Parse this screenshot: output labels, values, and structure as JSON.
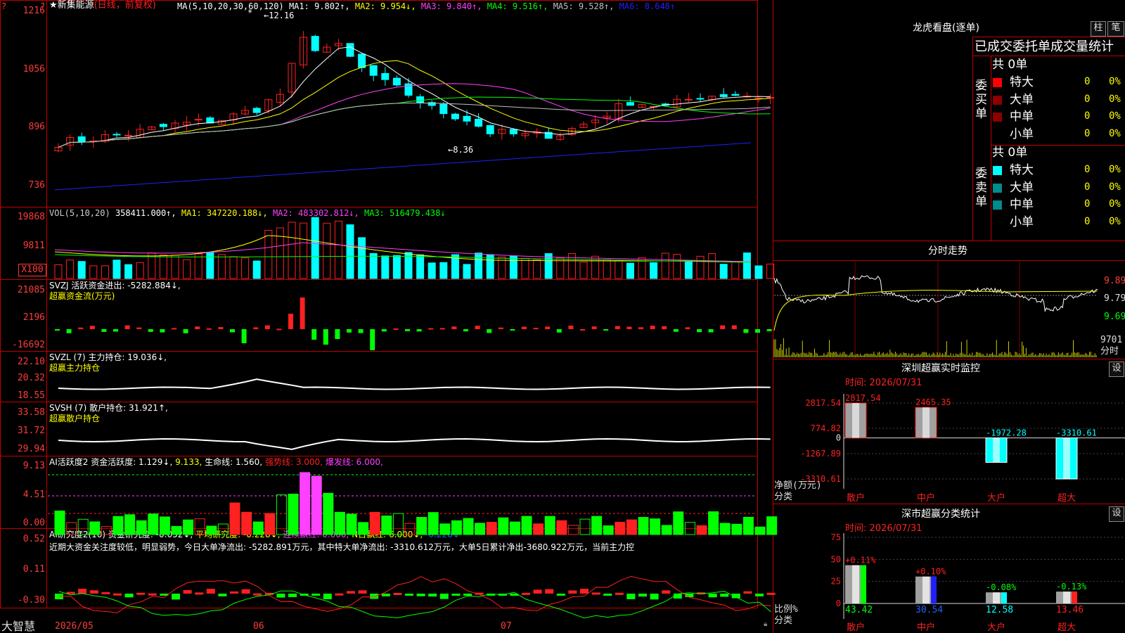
{
  "colors": {
    "up": "#ff2020",
    "down": "#00ffff",
    "green": "#00ff00",
    "yellow": "#ffff00",
    "magenta": "#ff40ff",
    "white": "#ffffff",
    "axis": "#ff3b3b",
    "ma1": "#ffffff",
    "ma2": "#ffff00",
    "ma3": "#ff40ff",
    "ma4": "#00ff00",
    "ma5": "#c0c0c0",
    "ma6": "#2020ff"
  },
  "main": {
    "stock_name": "★新集能源",
    "mode": "(日线，前复权)",
    "ma_label": "MA(5,10,20,30,60,120)",
    "ma1": "MA1: 9.802↑,",
    "ma2": "MA2: 9.954↓,",
    "ma3": "MA3: 9.840↑,",
    "ma4": "MA4: 9.516↑,",
    "ma5": "MA5: 9.528↑,",
    "ma6": "MA6: 8.648↑",
    "y_ticks": [
      "1216",
      "1056",
      "896",
      "736"
    ],
    "high_marker": "12.16",
    "low_marker": "8.36"
  },
  "vol": {
    "label": "VOL(5,10,20)",
    "value": "358411.000↑,",
    "ma1": "MA1: 347220.188↓,",
    "ma2": "MA2: 483302.812↓,",
    "ma3": "MA3: 516479.438↓",
    "y_ticks": [
      "19868",
      "9811"
    ],
    "unit": "X100"
  },
  "svzj": {
    "label": "SVZJ  活跃资金进出: -5282.884↓,",
    "sub": "超赢资金流(万元)",
    "y_ticks": [
      "21085",
      "2196",
      "-16692"
    ]
  },
  "svzl": {
    "label": "SVZL (7) 主力持仓: 19.036↓,",
    "sub": "超赢主力持仓",
    "y_ticks": [
      "22.10",
      "20.32",
      "18.55"
    ]
  },
  "svsh": {
    "label": "SVSH (7) 散户持仓: 31.921↑,",
    "sub": "超赢散户持仓",
    "y_ticks": [
      "33.58",
      "31.72",
      "29.94"
    ]
  },
  "ai1": {
    "a": "AI活跃度2 资金活跃度: 1.129↓,",
    "b": "9.133,",
    "c": "生命线: 1.560,",
    "d": "强势线: 3.000,",
    "e": "爆发线: 6.000,",
    "y_ticks": [
      "9.13",
      "4.51",
      "0.00"
    ]
  },
  "ai2": {
    "a": "AI研究度2(10) 资金研究度: -0.052↓,",
    "b": "平均研究度: -0.228↓,",
    "c": "连续飘红: 0.000,",
    "d": "N日飘红: 6.000↓,",
    "e": "-0.228↓",
    "note": "近期大资金关注度较低，明显弱势，今日大单净流出: -5282.891万元，其中特大单净流出: -3310.612万元，大单5日累计净出-3680.922万元，当前主力控",
    "y_ticks": [
      "0.52",
      "0.11",
      "-0.30"
    ]
  },
  "x_axis": {
    "labels": [
      "2026/05",
      "06",
      "07"
    ]
  },
  "logo": "大智慧",
  "dragon": {
    "title": "龙虎看盘(逐单)",
    "tab_pillar": "柱",
    "tab_pen": "笔",
    "header": "已成交委托单成交量统计",
    "buy_total": "共 0单",
    "buy_label": "委买单",
    "sell_total": "共 0单",
    "sell_label": "委卖单",
    "buy_rows": [
      {
        "name": "特大",
        "val": "0",
        "pct": "0%"
      },
      {
        "name": "大单",
        "val": "0",
        "pct": "0%"
      },
      {
        "name": "中单",
        "val": "0",
        "pct": "0%"
      },
      {
        "name": "小单",
        "val": "0",
        "pct": "0%"
      }
    ],
    "sell_rows": [
      {
        "name": "特大",
        "val": "0",
        "pct": "0%"
      },
      {
        "name": "大单",
        "val": "0",
        "pct": "0%"
      },
      {
        "name": "中单",
        "val": "0",
        "pct": "0%"
      },
      {
        "name": "小单",
        "val": "0",
        "pct": "0%"
      }
    ]
  },
  "intraday": {
    "title": "分时走势",
    "y_ticks": [
      "9.89",
      "9.79",
      "9.69"
    ],
    "vol_tick": "9701",
    "vol_label": "分时"
  },
  "sz_monitor": {
    "title": "深圳超赢实时监控",
    "settings": "设",
    "time": "时间: 2026/07/31",
    "y_ticks": [
      "2817.54",
      "774.82",
      "0",
      "-1267.89",
      "-3310.61"
    ],
    "axis_name": "净额(万元)",
    "cat_name": "分类",
    "categories": [
      "散户",
      "中户",
      "大户",
      "超大"
    ],
    "values": [
      2817.54,
      2465.35,
      -1972.28,
      -3310.61
    ],
    "value_labels": [
      "2817.54",
      "2465.35",
      "-1972.28",
      "-3310.61"
    ]
  },
  "sz_class": {
    "title": "深市超赢分类统计",
    "settings": "设",
    "time": "时间: 2026/07/31",
    "y_ticks": [
      "75",
      "50",
      "25",
      "0"
    ],
    "axis_name": "比例%",
    "cat_name": "分类",
    "categories": [
      "散户",
      "中户",
      "大户",
      "超大"
    ],
    "values": [
      43.42,
      30.54,
      12.58,
      13.46
    ],
    "value_labels": [
      "43.42",
      "30.54",
      "12.58",
      "13.46"
    ],
    "changes": [
      "+0.11%",
      "+0.10%",
      "-0.08%",
      "-0.13%"
    ]
  },
  "chart_data": [
    {
      "type": "bar",
      "title": "深圳超赢实时监控",
      "ylabel": "净额(万元)",
      "xlabel": "分类",
      "categories": [
        "散户",
        "中户",
        "大户",
        "超大"
      ],
      "values": [
        2817.54,
        2465.35,
        -1972.28,
        -3310.61
      ],
      "ylim": [
        -3310.61,
        2817.54
      ]
    },
    {
      "type": "bar",
      "title": "深市超赢分类统计",
      "ylabel": "比例%",
      "xlabel": "分类",
      "categories": [
        "散户",
        "中户",
        "大户",
        "超大"
      ],
      "values": [
        43.42,
        30.54,
        12.58,
        13.46
      ],
      "ylim": [
        0,
        75
      ]
    }
  ]
}
